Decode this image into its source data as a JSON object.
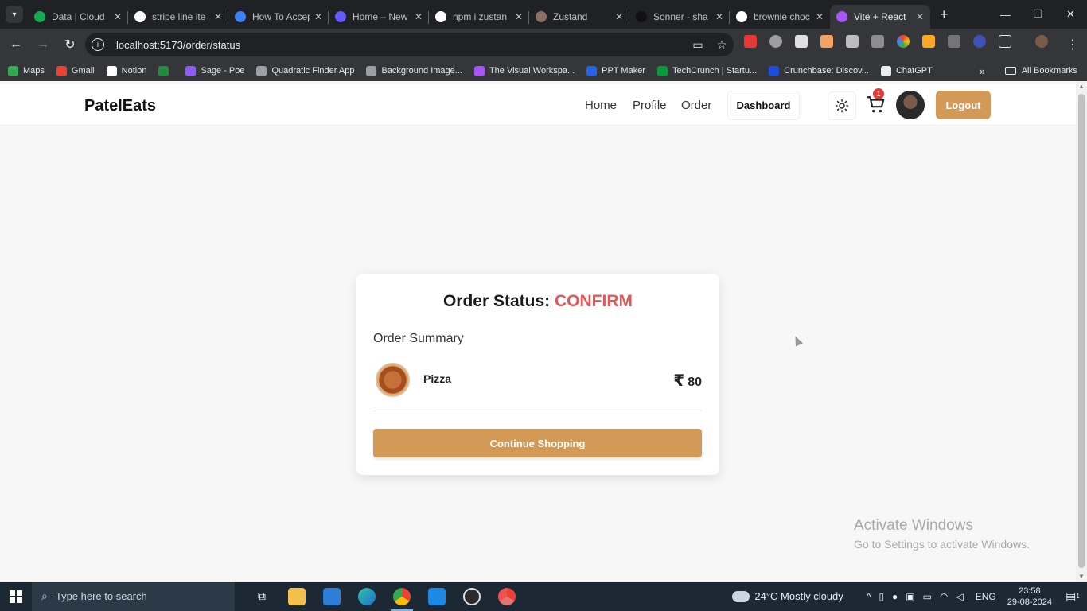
{
  "browser": {
    "tabs": [
      {
        "title": "Data | Cloud",
        "icon": "mongodb-icon",
        "color": "#13aa52"
      },
      {
        "title": "stripe line ite",
        "icon": "google-icon",
        "color": "#ffffff"
      },
      {
        "title": "How To Accep",
        "icon": "site-icon",
        "color": "#3b82f6"
      },
      {
        "title": "Home – New",
        "icon": "stripe-icon",
        "color": "#635bff"
      },
      {
        "title": "npm i zustan",
        "icon": "google-icon",
        "color": "#ffffff"
      },
      {
        "title": "Zustand",
        "icon": "bear-icon",
        "color": "#8d6e63"
      },
      {
        "title": "Sonner - sha",
        "icon": "shadcn-icon",
        "color": "#111111"
      },
      {
        "title": "brownie choc",
        "icon": "google-icon",
        "color": "#ffffff"
      },
      {
        "title": "Vite + React",
        "icon": "vite-icon",
        "color": "#a855f7"
      }
    ],
    "url": "localhost:5173/order/status",
    "bookmarks": [
      {
        "label": "Maps",
        "color": "#34a853"
      },
      {
        "label": "Gmail",
        "color": "#ea4335"
      },
      {
        "label": "Notion",
        "color": "#ffffff"
      },
      {
        "label": "",
        "color": "#1e8e3e"
      },
      {
        "label": "Sage - Poe",
        "color": "#8b5cf6"
      },
      {
        "label": "Quadratic Finder App",
        "color": "#9aa0a6"
      },
      {
        "label": "Background Image...",
        "color": "#9aa0a6"
      },
      {
        "label": "The Visual Workspa...",
        "color": "#a855f7"
      },
      {
        "label": "PPT Maker",
        "color": "#2563eb"
      },
      {
        "label": "TechCrunch | Startu...",
        "color": "#0a9a3c"
      },
      {
        "label": "Crunchbase: Discov...",
        "color": "#1d4ed8"
      },
      {
        "label": "ChatGPT",
        "color": "#e8eaed"
      }
    ],
    "all_bookmarks": "All Bookmarks"
  },
  "app": {
    "brand": "PatelEats",
    "nav": {
      "home": "Home",
      "profile": "Profile",
      "order": "Order",
      "dashboard": "Dashboard",
      "logout": "Logout"
    },
    "cart_count": "1",
    "accent": "#d39a57"
  },
  "order": {
    "status_label": "Order Status:",
    "status_value": "CONFIRM",
    "summary_title": "Order Summary",
    "item_name": "Pizza",
    "currency": "₹",
    "item_price": "80",
    "continue_label": "Continue Shopping"
  },
  "watermark": {
    "line1": "Activate Windows",
    "line2": "Go to Settings to activate Windows."
  },
  "taskbar": {
    "search_placeholder": "Type here to search",
    "weather": "24°C  Mostly cloudy",
    "lang": "ENG",
    "time": "23:58",
    "date": "29-08-2024",
    "notif_count": "1"
  }
}
